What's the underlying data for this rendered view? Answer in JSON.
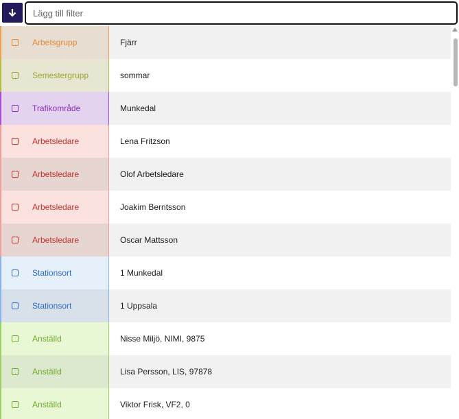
{
  "filter": {
    "placeholder": "Lägg till filter",
    "value": ""
  },
  "sort_button": {
    "icon": "arrow-down-icon"
  },
  "rows": [
    {
      "type": "Arbetsgrupp",
      "value": "Fjärr",
      "type_bg": "#e8ddd1",
      "value_bg": "#f1f1f1",
      "text_color": "#e08a3a",
      "line": "#e5a35c"
    },
    {
      "type": "Semestergrupp",
      "value": "sommar",
      "type_bg": "#e7e6d3",
      "value_bg": "#ffffff",
      "text_color": "#9aa830",
      "line": "#b3bd53"
    },
    {
      "type": "Trafikområde",
      "value": "Munkedal",
      "type_bg": "#e3d3ee",
      "value_bg": "#f1f1f1",
      "text_color": "#8a2fbf",
      "line": "#a553cf"
    },
    {
      "type": "Arbetsledare",
      "value": "Lena Fritzson",
      "type_bg": "#fbe2df",
      "value_bg": "#ffffff",
      "text_color": "#c2332b",
      "line": "#e8a39e"
    },
    {
      "type": "Arbetsledare",
      "value": "Olof Arbetsledare",
      "type_bg": "#e7d5d1",
      "value_bg": "#f1f1f1",
      "text_color": "#c2332b",
      "line": "#e8a39e"
    },
    {
      "type": "Arbetsledare",
      "value": "Joakim Berntsson",
      "type_bg": "#fbe2df",
      "value_bg": "#ffffff",
      "text_color": "#c2332b",
      "line": "#e8a39e"
    },
    {
      "type": "Arbetsledare",
      "value": "Oscar Mattsson",
      "type_bg": "#e7d5d1",
      "value_bg": "#f1f1f1",
      "text_color": "#c2332b",
      "line": "#e8a39e"
    },
    {
      "type": "Stationsort",
      "value": "1 Munkedal",
      "type_bg": "#e5f0fb",
      "value_bg": "#ffffff",
      "text_color": "#2f6bc4",
      "line": "#8db4e6"
    },
    {
      "type": "Stationsort",
      "value": "1 Uppsala",
      "type_bg": "#d8e0e9",
      "value_bg": "#f1f1f1",
      "text_color": "#2f6bc4",
      "line": "#8db4e6"
    },
    {
      "type": "Anställd",
      "value": "Nisse Miljö, NIMI, 9875",
      "type_bg": "#e8f8d4",
      "value_bg": "#ffffff",
      "text_color": "#6ea82a",
      "line": "#9fcf6a"
    },
    {
      "type": "Anställd",
      "value": "Lisa Persson, LIS, 97878",
      "type_bg": "#dde9cf",
      "value_bg": "#f1f1f1",
      "text_color": "#6ea82a",
      "line": "#9fcf6a"
    },
    {
      "type": "Anställd",
      "value": "Viktor Frisk, VF2, 0",
      "type_bg": "#e8f8d4",
      "value_bg": "#ffffff",
      "text_color": "#6ea82a",
      "line": "#9fcf6a"
    }
  ]
}
